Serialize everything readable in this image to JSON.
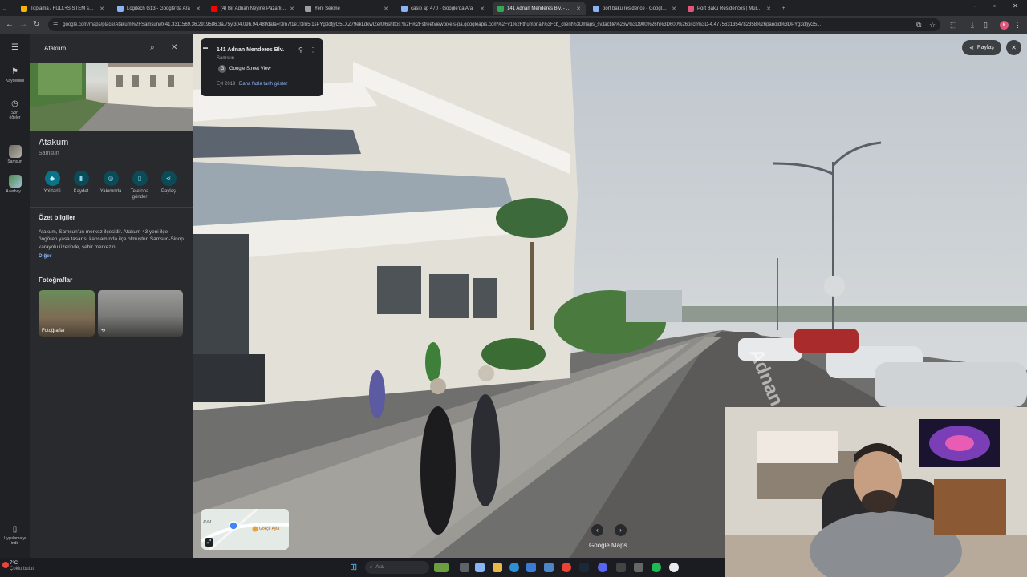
{
  "browser": {
    "tabs": [
      {
        "title": "Toplama / FULL+SİSTEM sahibi...",
        "favicon_color": "#f4b400",
        "active": false
      },
      {
        "title": "Logitech G13 - Google'da Ara",
        "favicon_color": "#8ab4f8",
        "active": false
      },
      {
        "title": "(4) Bir Adnan Neyine Pazarlık Y...",
        "favicon_color": "#ff0000",
        "active": false
      },
      {
        "title": "Yeni Sekme",
        "favicon_color": "#9aa0a6",
        "active": false
      },
      {
        "title": "casio ap 470 - Google'da Ara",
        "favicon_color": "#8ab4f8",
        "active": false
      },
      {
        "title": "141 Adnan Menderes Blv. - Goo...",
        "favicon_color": "#34a853",
        "active": true
      },
      {
        "title": "port baku residence - Google'd...",
        "favicon_color": "#8ab4f8",
        "active": false
      },
      {
        "title": "Port Baku Residences | Muradh...",
        "favicon_color": "#e2567a",
        "active": false
      }
    ],
    "new_tab_label": "+",
    "url": "google.com/maps/place/Atakum%2FSamsun/@41.3311569,36.2919586,3a,75y,304.09h,94.48t/data=!3m7!1e1!3m5!1sPYg3dfjyG5LXZ79ekLdkwIZe!0!6shttps:%2F%2Fstreetviewpixels-pa.googleapis.com%2Fv1%2Fthumbnail%3Fcb_client%3Dmaps_sv.tactile%26w%3D900%26h%3D600%26pitch%3D-4.4775631354782358%26panoid%3DPYg3dfjyG5...",
    "profile_initial": "K"
  },
  "rail": {
    "menu_icon": "menu-icon",
    "saved_label": "Kaydedildi",
    "recent_label": "Son öğeler",
    "recent_1_label": "Samsun",
    "recent_2_label": "Azerbay...",
    "app_label": "Uygulama yı indir"
  },
  "panel": {
    "search_value": "Atakum",
    "place_title": "Atakum",
    "place_subtitle": "Samsun",
    "actions": [
      {
        "label": "Yol tarifi",
        "icon": "directions-icon"
      },
      {
        "label": "Kaydet",
        "icon": "bookmark-icon"
      },
      {
        "label": "Yakınında",
        "icon": "nearby-icon"
      },
      {
        "label": "Telefona gönder",
        "icon": "phone-icon"
      },
      {
        "label": "Paylaş",
        "icon": "share-icon"
      }
    ],
    "overview_heading": "Özet bilgiler",
    "overview_text": "Atakum, Samsun'un merkez ilçesidir. Atakum 43 yeni ilçe öngören yasa tasarısı kapsamında ilçe olmuştur. Samsun-Sinop karayolu üzerinde, şehir merkezin...",
    "overview_more": "Diğer",
    "photos_heading": "Fotoğraflar",
    "photo_1_label": "Fotoğraflar"
  },
  "streetview": {
    "address": "141 Adnan Menderes Blv.",
    "city": "Samsun",
    "source": "Google Street View",
    "date": "Eyl 2019",
    "more_dates": "Daha fazla tarih göster",
    "share_label": "Paylaş",
    "watermark": "Google Maps",
    "street_name": "Adnan Menderes",
    "minimap_label_1": "AVM",
    "minimap_label_2": "Gökçe Ayla"
  },
  "taskbar": {
    "weather_temp": "7°C",
    "weather_desc": "Çoklu bulut",
    "search_placeholder": "Ara"
  }
}
